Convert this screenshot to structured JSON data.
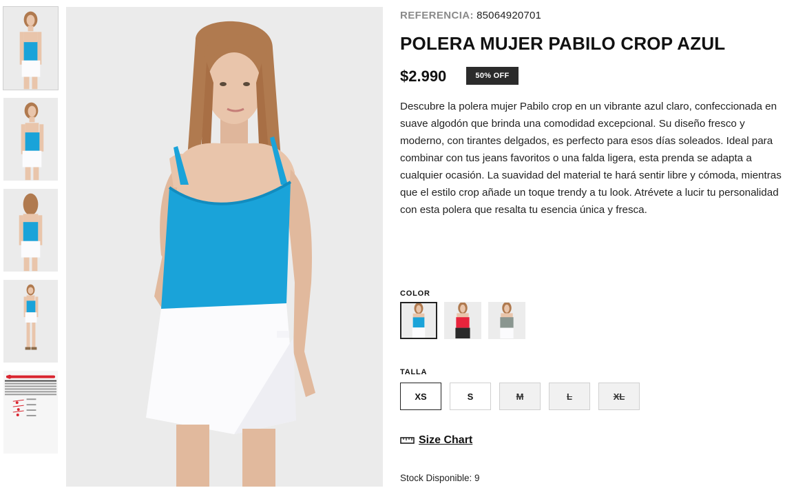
{
  "product": {
    "reference_label": "REFERENCIA:",
    "reference_value": "85064920701",
    "title": "POLERA MUJER PABILO CROP AZUL",
    "price": "$2.990",
    "discount_badge": "50% OFF",
    "description": "Descubre la polera mujer Pabilo crop en un vibrante azul claro, confeccionada en suave algodón que brinda una comodidad excepcional. Su diseño fresco y moderno, con tirantes delgados, es perfecto para esos días soleados. Ideal para combinar con tus jeans favoritos o una falda ligera, esta prenda se adapta a cualquier ocasión. La suavidad del material te hará sentir libre y cómoda, mientras que el estilo crop añade un toque trendy a tu look. Atrévete a lucir tu personalidad con esta polera que resalta tu esencia única y fresca.",
    "stock_text": "Stock Disponible: 9"
  },
  "color_section": {
    "label": "COLOR",
    "options": [
      {
        "name": "azul",
        "color": "#1aa3d9",
        "selected": true
      },
      {
        "name": "rojo",
        "color": "#e8243c",
        "selected": false
      },
      {
        "name": "gris",
        "color": "#8a9690",
        "selected": false
      }
    ]
  },
  "size_section": {
    "label": "TALLA",
    "options": [
      {
        "label": "XS",
        "available": true,
        "selected": true
      },
      {
        "label": "S",
        "available": true,
        "selected": false
      },
      {
        "label": "M",
        "available": false,
        "selected": false
      },
      {
        "label": "L",
        "available": false,
        "selected": false
      },
      {
        "label": "XL",
        "available": false,
        "selected": false
      }
    ]
  },
  "size_chart": {
    "label": "Size Chart",
    "icon": "ruler-icon"
  },
  "gallery": {
    "thumbnails": [
      "front",
      "front-side",
      "back",
      "full-body",
      "size-chart"
    ],
    "active_index": 0
  },
  "colors": {
    "top_blue": "#1aa3d9",
    "badge_bg": "#2b2b2b",
    "image_bg": "#ebebeb",
    "hair": "#b07a4f",
    "skin": "#e9c5ab"
  }
}
